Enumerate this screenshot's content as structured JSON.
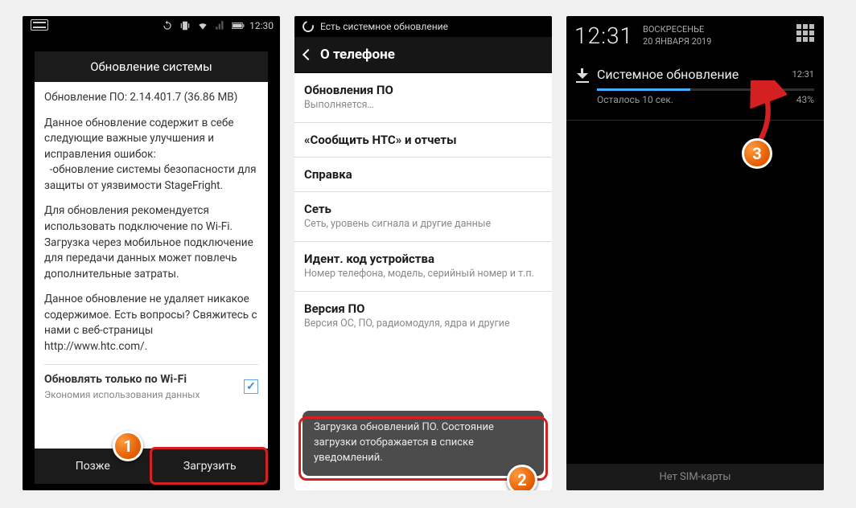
{
  "phone1": {
    "status_time": "12:30",
    "dialog_title": "Обновление системы",
    "version_line": "Обновление ПО: 2.14.401.7 (36.86 MB)",
    "desc1": "Данное обновление содержит в себе следующие важные улучшения и исправления ошибок:",
    "desc1b": "  -обновление системы безопасности для защиты от уязвимости StageFright.",
    "desc2": "Для обновления рекомендуется использовать подключение по Wi-Fi. Загрузка через мобильное подключение для передачи данных может повлечь дополнительные затраты.",
    "desc3": "Данное обновление не удаляет никакое содержимое. Есть вопросы? Свяжитесь с нами с веб-страницы http://www.htc.com/.",
    "wifi_title": "Обновлять только по Wi-Fi",
    "wifi_sub": "Экономия использования данных",
    "btn_later": "Позже",
    "btn_download": "Загрузить",
    "marker": "1"
  },
  "phone2": {
    "status_text": "Есть системное обновление",
    "header": "О телефоне",
    "items": [
      {
        "title": "Обновления ПО",
        "sub": "Выполняется…"
      },
      {
        "title": "«Сообщить HTC» и отчеты",
        "sub": ""
      },
      {
        "title": "Справка",
        "sub": ""
      },
      {
        "title": "Сеть",
        "sub": "Сеть, уровень сигнала и другие данные"
      },
      {
        "title": "Идент. код устройства",
        "sub": "Номер телефона, модель, серийный номер и т.п."
      },
      {
        "title": "Версия ПО",
        "sub": "Версия ОС, ПО, радиомодуля, ядра и другие"
      }
    ],
    "toast": "Загрузка обновлений ПО. Состояние загрузки отображается в списке уведомлений.",
    "marker": "2"
  },
  "phone3": {
    "time": "12:31",
    "day": "ВОСКРЕСЕНЬЕ",
    "date": "20 ЯНВАРЯ 2019",
    "notif_title": "Системное обновление",
    "notif_time": "12:31",
    "remaining": "Осталось 10 сек.",
    "percent": "43%",
    "percent_value": 43,
    "footer": "Нет SIM-карты",
    "marker": "3"
  }
}
